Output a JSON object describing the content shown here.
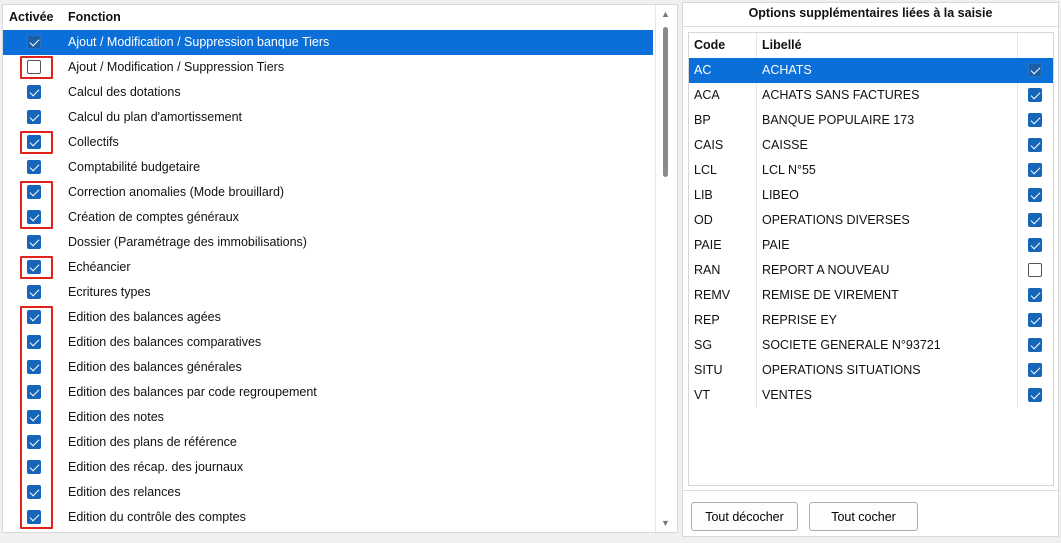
{
  "left": {
    "headers": {
      "active": "Activée",
      "function": "Fonction"
    },
    "rows": [
      {
        "label": "Ajout / Modification / Suppression banque Tiers",
        "checked": true,
        "selected": true,
        "highlighted": false
      },
      {
        "label": "Ajout / Modification / Suppression Tiers",
        "checked": false,
        "selected": false,
        "highlighted": true
      },
      {
        "label": "Calcul des dotations",
        "checked": true,
        "selected": false,
        "highlighted": false
      },
      {
        "label": "Calcul du plan d'amortissement",
        "checked": true,
        "selected": false,
        "highlighted": false
      },
      {
        "label": "Collectifs",
        "checked": true,
        "selected": false,
        "highlighted": true
      },
      {
        "label": "Comptabilité budgetaire",
        "checked": true,
        "selected": false,
        "highlighted": false
      },
      {
        "label": "Correction anomalies (Mode brouillard)",
        "checked": true,
        "selected": false,
        "highlighted": true
      },
      {
        "label": "Création de comptes généraux",
        "checked": true,
        "selected": false,
        "highlighted": true
      },
      {
        "label": "Dossier (Paramétrage des immobilisations)",
        "checked": true,
        "selected": false,
        "highlighted": false
      },
      {
        "label": "Echéancier",
        "checked": true,
        "selected": false,
        "highlighted": true
      },
      {
        "label": "Ecritures types",
        "checked": true,
        "selected": false,
        "highlighted": false
      },
      {
        "label": "Edition des balances agées",
        "checked": true,
        "selected": false,
        "highlighted": true
      },
      {
        "label": "Edition des balances comparatives",
        "checked": true,
        "selected": false,
        "highlighted": true
      },
      {
        "label": "Edition des balances générales",
        "checked": true,
        "selected": false,
        "highlighted": true
      },
      {
        "label": "Edition des balances par code regroupement",
        "checked": true,
        "selected": false,
        "highlighted": true
      },
      {
        "label": "Edition des notes",
        "checked": true,
        "selected": false,
        "highlighted": true
      },
      {
        "label": "Edition des plans de référence",
        "checked": true,
        "selected": false,
        "highlighted": true
      },
      {
        "label": "Edition des récap. des journaux",
        "checked": true,
        "selected": false,
        "highlighted": true
      },
      {
        "label": "Edition des relances",
        "checked": true,
        "selected": false,
        "highlighted": true
      },
      {
        "label": "Edition du contrôle des comptes",
        "checked": true,
        "selected": false,
        "highlighted": true
      }
    ]
  },
  "right": {
    "title": "Options supplémentaires liées à la saisie",
    "headers": {
      "code": "Code",
      "label": "Libellé"
    },
    "rows": [
      {
        "code": "AC",
        "label": "ACHATS",
        "checked": true,
        "selected": true
      },
      {
        "code": "ACA",
        "label": "ACHATS SANS FACTURES",
        "checked": true,
        "selected": false
      },
      {
        "code": "BP",
        "label": "BANQUE POPULAIRE 173",
        "checked": true,
        "selected": false
      },
      {
        "code": "CAIS",
        "label": "CAISSE",
        "checked": true,
        "selected": false
      },
      {
        "code": "LCL",
        "label": "LCL N°55",
        "checked": true,
        "selected": false
      },
      {
        "code": "LIB",
        "label": "LIBEO",
        "checked": true,
        "selected": false
      },
      {
        "code": "OD",
        "label": "OPERATIONS DIVERSES",
        "checked": true,
        "selected": false
      },
      {
        "code": "PAIE",
        "label": "PAIE",
        "checked": true,
        "selected": false
      },
      {
        "code": "RAN",
        "label": "REPORT A NOUVEAU",
        "checked": false,
        "selected": false
      },
      {
        "code": "REMV",
        "label": "REMISE DE VIREMENT",
        "checked": true,
        "selected": false
      },
      {
        "code": "REP",
        "label": "REPRISE EY",
        "checked": true,
        "selected": false
      },
      {
        "code": "SG",
        "label": "SOCIETE GENERALE N°93721",
        "checked": true,
        "selected": false
      },
      {
        "code": "SITU",
        "label": "OPERATIONS SITUATIONS",
        "checked": true,
        "selected": false
      },
      {
        "code": "VT",
        "label": "VENTES",
        "checked": true,
        "selected": false
      }
    ],
    "buttons": {
      "uncheck_all": "Tout décocher",
      "check_all": "Tout cocher"
    }
  }
}
